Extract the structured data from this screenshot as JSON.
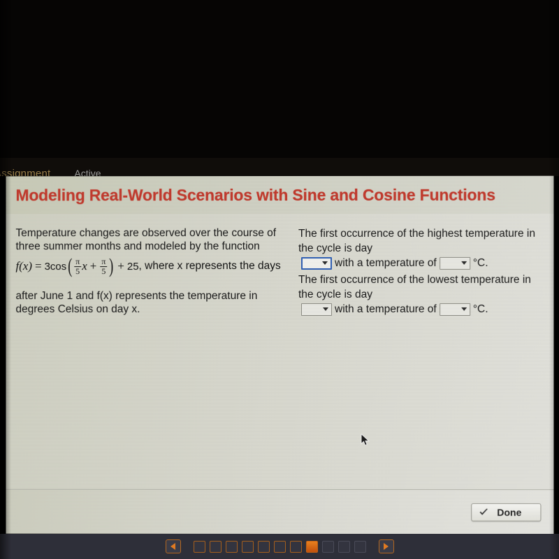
{
  "top_nav": {
    "assignment_label": "Assignment",
    "active_label": "Active"
  },
  "header": {
    "title": "Modeling Real-World Scenarios with Sine and Cosine Functions",
    "title_color": "#c2392c"
  },
  "left_column": {
    "paragraph_1": "Temperature changes are observed over the course of three summer months and modeled by the function",
    "formula": {
      "lhs": "f(x)",
      "equals": "=",
      "coefficient": "3cos",
      "open_paren": "(",
      "frac1_numerator": "π",
      "frac1_denominator": "5",
      "variable": "x",
      "plus_inner": "+",
      "frac2_numerator": "π",
      "frac2_denominator": "5",
      "close_paren": ")",
      "plus_outer": "+",
      "constant": "25",
      "trailing_text": ", where x represents the days"
    },
    "paragraph_2": "after June 1 and f(x) represents the temperature in degrees Celsius on day x."
  },
  "right_column": {
    "questions": [
      {
        "text_part_1": "The first occurrence of the highest temperature in the cycle is day",
        "dropdown_day": {
          "value": "",
          "focused": true,
          "icon": "chevron-down-icon"
        },
        "text_part_2": "with a temperature of",
        "dropdown_temp": {
          "value": "",
          "focused": false,
          "icon": "chevron-down-icon"
        },
        "text_part_3": "°C."
      },
      {
        "text_part_1": "The first occurrence of the lowest temperature in the cycle is day",
        "dropdown_day": {
          "value": "",
          "focused": false,
          "icon": "chevron-down-icon"
        },
        "text_part_2": "with a temperature of",
        "dropdown_temp": {
          "value": "",
          "focused": false,
          "icon": "chevron-down-icon"
        },
        "text_part_3": "°C."
      }
    ]
  },
  "footer": {
    "done_label": "Done",
    "done_icon": "checkmark-icon"
  },
  "pager": {
    "prev_icon": "triangle-left-icon",
    "next_icon": "triangle-right-icon",
    "total_boxes": 11,
    "active_index": 8,
    "completed_count": 7
  }
}
